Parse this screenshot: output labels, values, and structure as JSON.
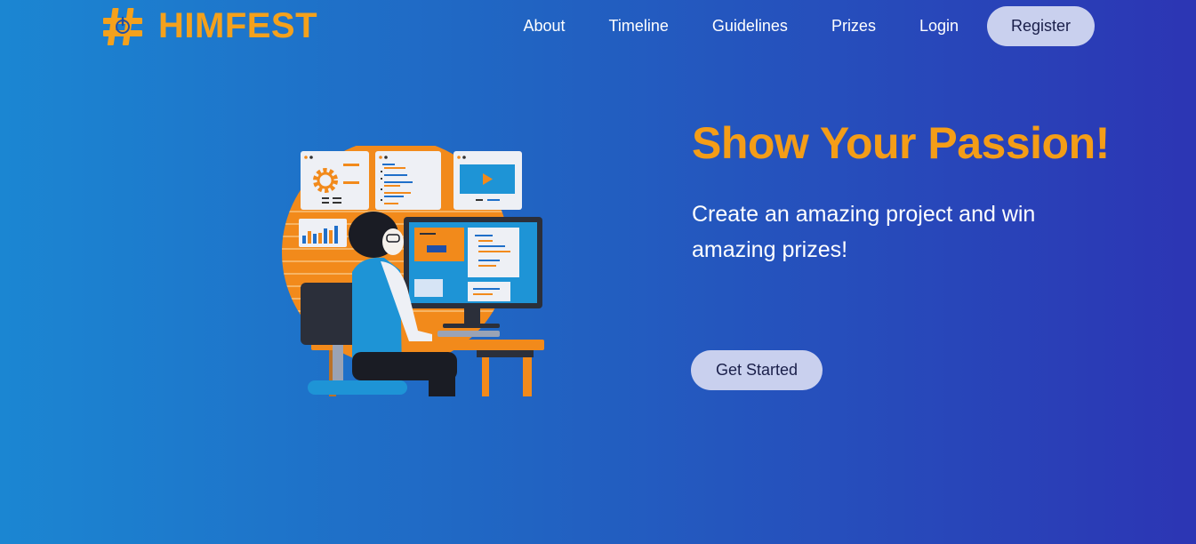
{
  "brand": {
    "name": "HIMFEST",
    "accent_color": "#f4a11c",
    "icon": "hashtag-power-icon"
  },
  "nav": {
    "links": [
      {
        "label": "About"
      },
      {
        "label": "Timeline"
      },
      {
        "label": "Guidelines"
      },
      {
        "label": "Prizes"
      },
      {
        "label": "Login"
      }
    ],
    "register_label": "Register"
  },
  "hero": {
    "title": "Show Your Passion!",
    "subtitle": "Create an amazing project and win amazing prizes!",
    "cta_label": "Get Started",
    "illustration": "developer-at-computer-illustration"
  },
  "colors": {
    "background_start": "#1b86d2",
    "background_end": "#2c35b4",
    "title": "#f49d17",
    "button_bg": "#c9d0ee",
    "button_text": "#1a1f4a"
  }
}
